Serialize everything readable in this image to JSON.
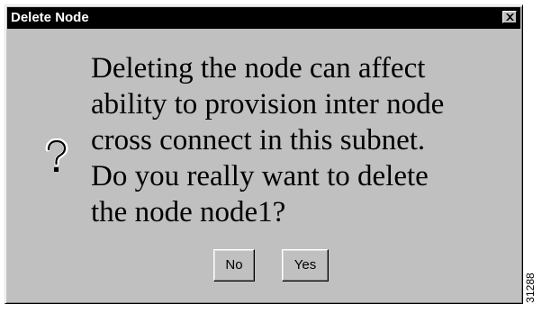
{
  "dialog": {
    "title": "Delete Node",
    "close_icon": "close-icon",
    "message_icon": "question-icon",
    "message": "Deleting the node can affect\nability to provision inter node\ncross connect in this subnet.\nDo you really want to delete\nthe node node1?",
    "buttons": {
      "no_label": "No",
      "yes_label": "Yes"
    }
  },
  "figure_number": "31288"
}
